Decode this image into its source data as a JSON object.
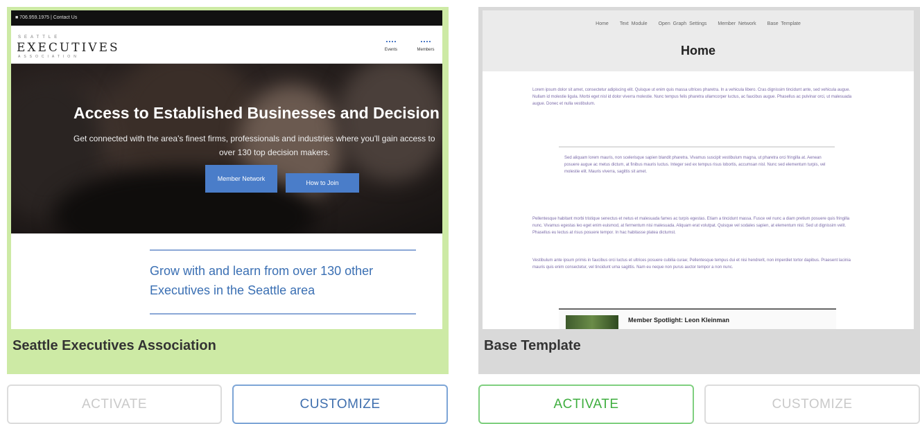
{
  "templates": [
    {
      "name": "Seattle Executives Association",
      "preview": {
        "topbar": "■ 706.959.1975 | Contact Us",
        "logo_small": "SEATTLE",
        "logo": "EXECUTIVES",
        "logo_sub": "ASSOCIATION",
        "nav": [
          "Events",
          "Members"
        ],
        "hero_title": "Access to Established Businesses and Decision Makers",
        "hero_text_1": "Get connected with the area's finest firms, professionals and industries where you'll gain access to",
        "hero_text_2": "over 130 top decision makers.",
        "btn_member": "Member Network",
        "btn_join": "How to Join",
        "grow_text": "Grow with and learn from over 130 other Executives in the Seattle area"
      },
      "activate_label": "ACTIVATE",
      "customize_label": "CUSTOMIZE",
      "active": true
    },
    {
      "name": "Base Template",
      "preview": {
        "nav": [
          "Home",
          "Text Module",
          "Open Graph Settings",
          "Member Network",
          "Base Template"
        ],
        "title": "Home",
        "para_1": "Lorem ipsum dolor sit amet, consectetur adipiscing elit. Quisque ut enim quis massa ultrices pharetra. In a vehicula libero. Cras dignissim tincidunt ante, sed vehicula augue. Nullam id molestie ligula. Morbi eget nisl id dolor viverra molestie. Nunc tempus felis pharetra ullamcorper luctus, ac faucibus augue. Phasellus ac pulvinar orci, ut malesuada augue. Donec et nulla vestibulum.",
        "quote": "Sed aliquam lorem mauris, non scelerisque sapien blandit pharetra. Vivamus suscipit vestibulum magna, ut pharetra orci fringilla at. Aenean posuere augue ac metus dictum, at finibus mauris luctus. Integer sed ex tempus risus lobortis, accumsan nisl. Nunc sed elementum turpis, vel molestie elit. Mauris viverra, sagittis sit amet.",
        "para_2": "Pellentesque habitant morbi tristique senectus et netus et malesuada fames ac turpis egestas. Etiam a tincidunt massa. Fusce vel nunc a diam pretium posuere quis fringilla nunc. Vivamus egestas leo eget enim euismod, at fermentum nisi malesuada. Aliquam erat volutpat. Quisque vel sodales sapien, at elementum nisl. Sed ut dignissim velit. Phasellus eu lectus at risus posuere tempor. In hac habitasse platea dictumst.",
        "para_3": "Vestibulum ante ipsum primis in faucibus orci luctus et ultrices posuere cubilia curae; Pellentesque tempus dui et nisi hendrerit, non imperdiet tortor dapibus. Praesent lacinia mauris quis enim consectetur, vel tincidunt urna sagittis. Nam eu neque non purus auctor tempor a non nunc.",
        "spotlight": "Member Spotlight: Leon Kleinman"
      },
      "activate_label": "ACTIVATE",
      "customize_label": "CUSTOMIZE",
      "active": false
    }
  ],
  "colors": {
    "selected_card": "#cdeaa5",
    "card": "#d9d9d9",
    "customize_accent": "#3f6fae",
    "activate_accent": "#3fae3f"
  }
}
